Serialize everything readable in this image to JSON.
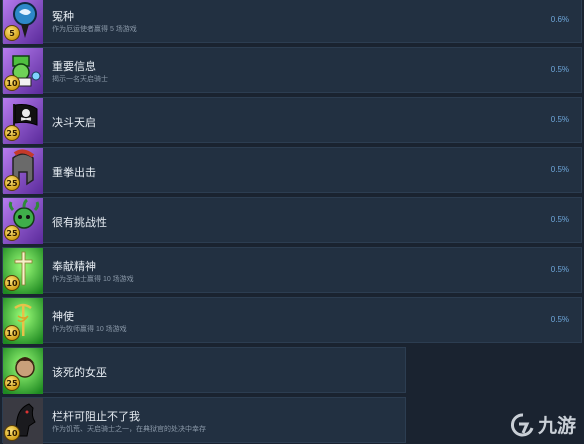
{
  "achievements": [
    {
      "title": "冤种",
      "desc": "作为厄运使者赢得 5 场游戏",
      "pct": "0.6%",
      "badge": "5",
      "icon": "dragon-moon-icon",
      "color": "#8a4dc7"
    },
    {
      "title": "重要信息",
      "desc": "揭示一名天启骑士",
      "pct": "0.5%",
      "badge": "10",
      "icon": "goblin-scroll-icon",
      "color": "#8a4dc7"
    },
    {
      "title": "决斗天启",
      "desc": "",
      "pct": "0.5%",
      "badge": "25",
      "icon": "pirate-flag-icon",
      "color": "#8a4dc7"
    },
    {
      "title": "重拳出击",
      "desc": "",
      "pct": "0.5%",
      "badge": "25",
      "icon": "spartan-helmet-icon",
      "color": "#8a4dc7"
    },
    {
      "title": "很有挑战性",
      "desc": "",
      "pct": "0.5%",
      "badge": "25",
      "icon": "medusa-icon",
      "color": "#8a4dc7"
    },
    {
      "title": "奉献精神",
      "desc": "作为圣骑士赢得 10 场游戏",
      "pct": "0.5%",
      "badge": "10",
      "icon": "holy-cross-icon",
      "color": "#3fbf3a"
    },
    {
      "title": "神使",
      "desc": "作为牧师赢得 10 场游戏",
      "pct": "0.5%",
      "badge": "10",
      "icon": "caduceus-icon",
      "color": "#3fbf3a"
    },
    {
      "title": "该死的女巫",
      "desc": "",
      "pct": "",
      "badge": "25",
      "icon": "witch-icon",
      "color": "#3fbf3a"
    },
    {
      "title": "栏杆可阻止不了我",
      "desc": "作为饥荒、天启骑士之一，在典狱官的处决中幸存",
      "pct": "",
      "badge": "10",
      "icon": "horse-head-icon",
      "color": "#4a4a52"
    }
  ],
  "watermark": {
    "text": "九游",
    "icon": "jiuyou-logo-icon"
  }
}
